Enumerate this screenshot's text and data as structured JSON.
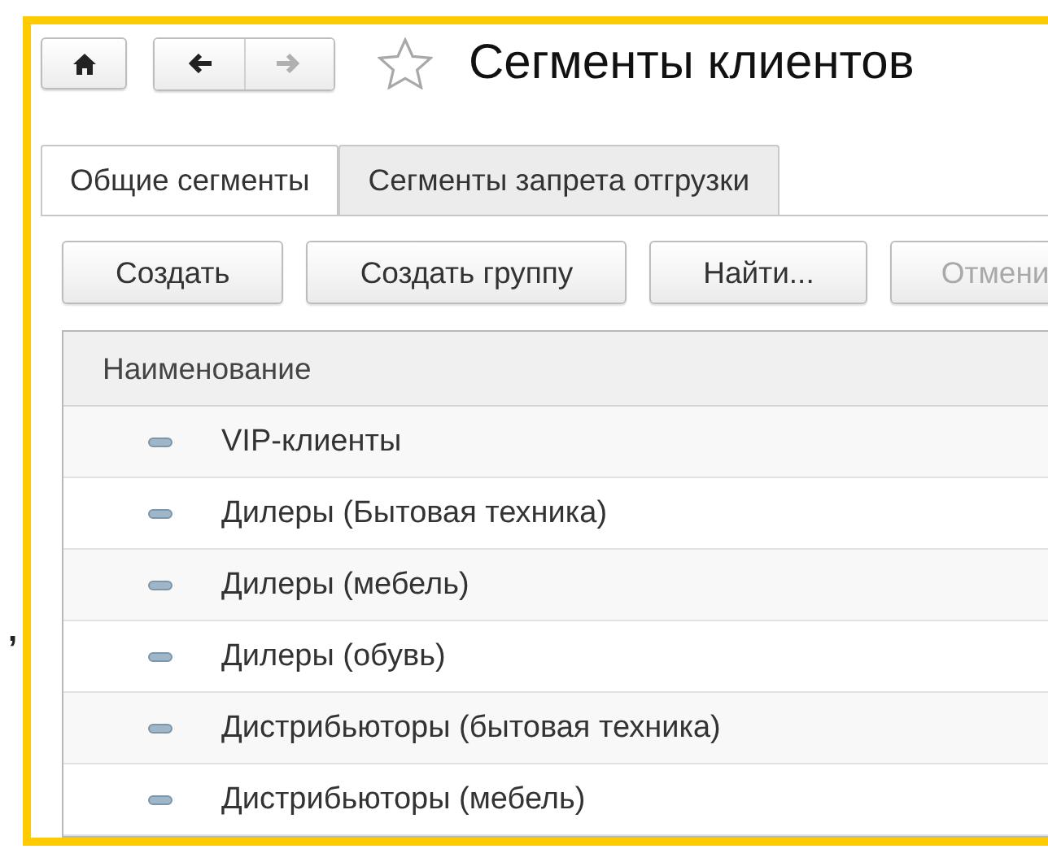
{
  "margin_note": ",",
  "nav": {
    "back_disabled": false,
    "forward_disabled": true
  },
  "window": {
    "title": "Сегменты клиентов",
    "favorite": false
  },
  "tabs": [
    {
      "label": "Общие сегменты",
      "selected": true
    },
    {
      "label": "Сегменты запрета отгрузки",
      "selected": false
    }
  ],
  "buttons": [
    {
      "label": "Создать",
      "disabled": false
    },
    {
      "label": "Создать группу",
      "disabled": false
    },
    {
      "label": "Найти...",
      "disabled": false
    },
    {
      "label": "Отмени",
      "disabled": true
    }
  ],
  "table": {
    "columns": [
      "Наименование"
    ],
    "rows": [
      {
        "name": "VIP-клиенты"
      },
      {
        "name": "Дилеры (Бытовая техника)"
      },
      {
        "name": "Дилеры (мебель)"
      },
      {
        "name": "Дилеры (обувь)"
      },
      {
        "name": "Дистрибьюторы (бытовая техника)"
      },
      {
        "name": "Дистрибьюторы (мебель)"
      }
    ]
  }
}
